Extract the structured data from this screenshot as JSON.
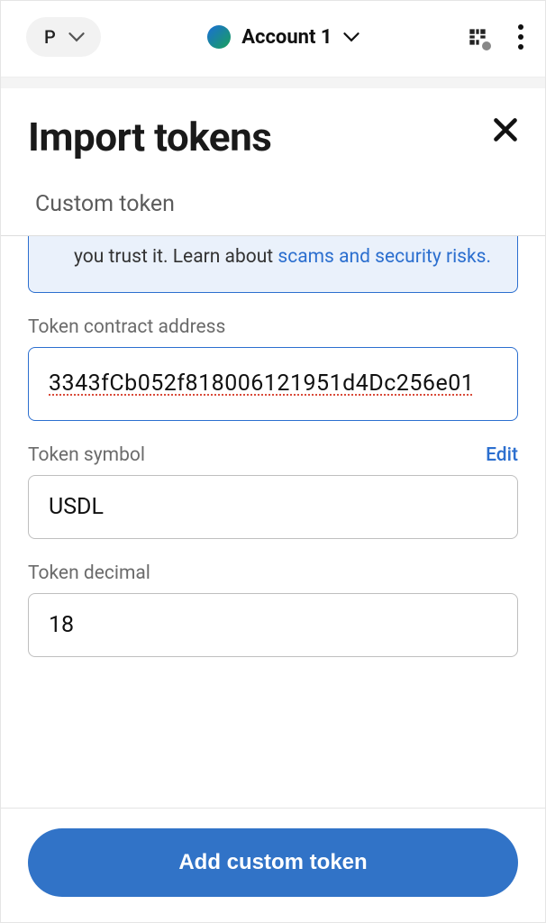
{
  "header": {
    "network_letter": "P",
    "account_name": "Account 1"
  },
  "modal": {
    "title": "Import tokens",
    "tab_label": "Custom token"
  },
  "warning": {
    "prefix": "you trust it. Learn about ",
    "link_text": "scams and security risks."
  },
  "fields": {
    "address_label": "Token contract address",
    "address_value": "3343fCb052f818006121951d4Dc256e01",
    "symbol_label": "Token symbol",
    "symbol_edit": "Edit",
    "symbol_value": "USDL",
    "decimal_label": "Token decimal",
    "decimal_value": "18"
  },
  "footer": {
    "button_label": "Add custom token"
  }
}
